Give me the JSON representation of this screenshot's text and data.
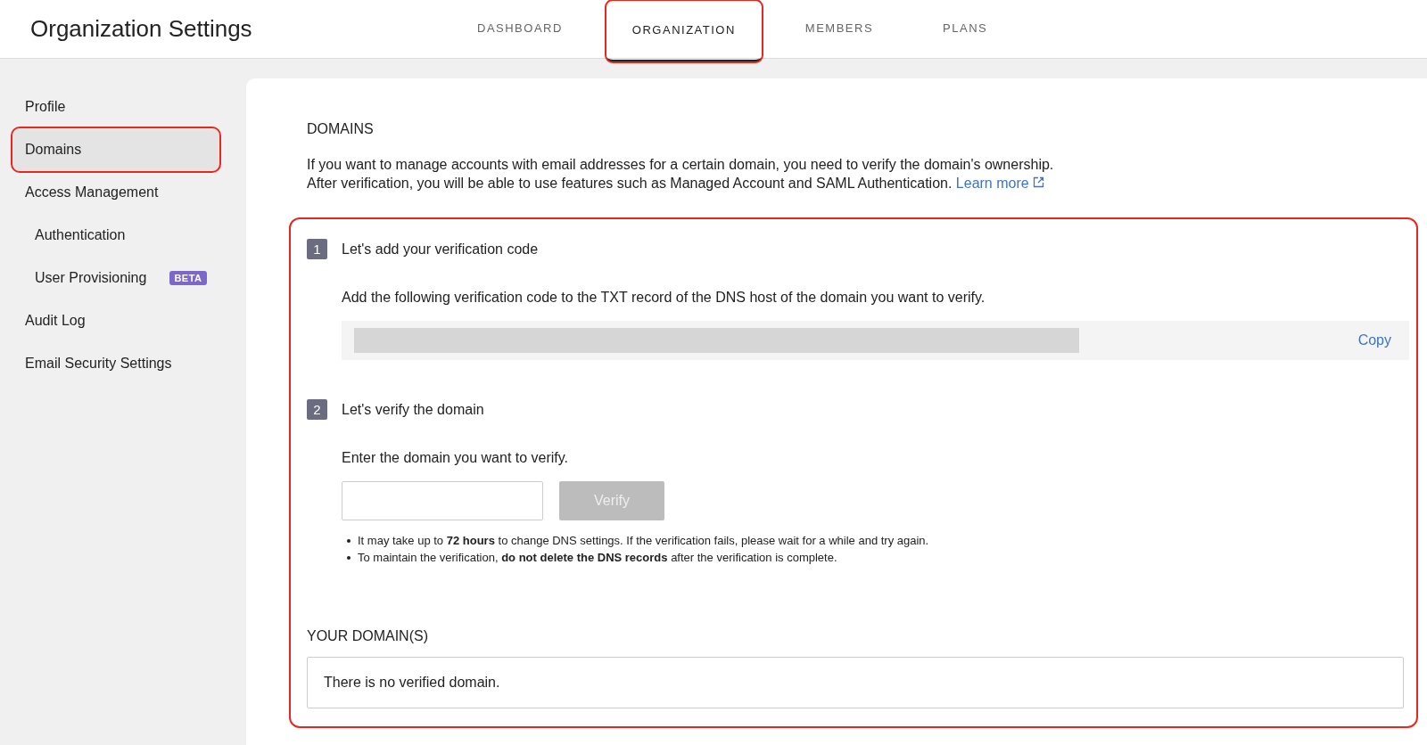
{
  "header": {
    "title": "Organization Settings"
  },
  "tabs": [
    {
      "label": "DASHBOARD",
      "selected": false,
      "highlighted": false
    },
    {
      "label": "ORGANIZATION",
      "selected": true,
      "highlighted": true
    },
    {
      "label": "MEMBERS",
      "selected": false,
      "highlighted": false
    },
    {
      "label": "PLANS",
      "selected": false,
      "highlighted": false
    }
  ],
  "sidebar": {
    "items": [
      {
        "label": "Profile",
        "selected": false,
        "highlighted": false
      },
      {
        "label": "Domains",
        "selected": true,
        "highlighted": true
      },
      {
        "label": "Access Management",
        "selected": false,
        "highlighted": false,
        "children": [
          {
            "label": "Authentication",
            "selected": false,
            "highlighted": false
          },
          {
            "label": "User Provisioning",
            "badge": "BETA",
            "selected": false,
            "highlighted": false
          }
        ]
      },
      {
        "label": "Audit Log",
        "selected": false,
        "highlighted": false
      },
      {
        "label": "Email Security Settings",
        "selected": false,
        "highlighted": false
      }
    ]
  },
  "content": {
    "heading": "DOMAINS",
    "intro": [
      "If you want to manage accounts with email addresses for a certain domain, you need to verify the domain's ownership.",
      "After verification, you will be able to use features such as Managed Account and SAML Authentication."
    ],
    "learn_more": "Learn more",
    "steps_highlighted": true,
    "step1": {
      "number": "1",
      "title": "Let's add your verification code",
      "description": "Add the following verification code to the TXT record of the DNS host of the domain you want to verify.",
      "copy": "Copy"
    },
    "step2": {
      "number": "2",
      "title": "Let's verify the domain",
      "description": "Enter the domain you want to verify.",
      "verify_button": {
        "label": "Verify",
        "disabled": true
      },
      "notes": [
        "It may take up to **72 hours** to change DNS settings. If the verification fails, please wait for a while and try again.",
        "To maintain the verification, **do not delete the DNS records** after the verification is complete."
      ]
    },
    "your_domains": {
      "heading": "YOUR DOMAIN(S)",
      "empty_message": "There is no verified domain."
    }
  }
}
